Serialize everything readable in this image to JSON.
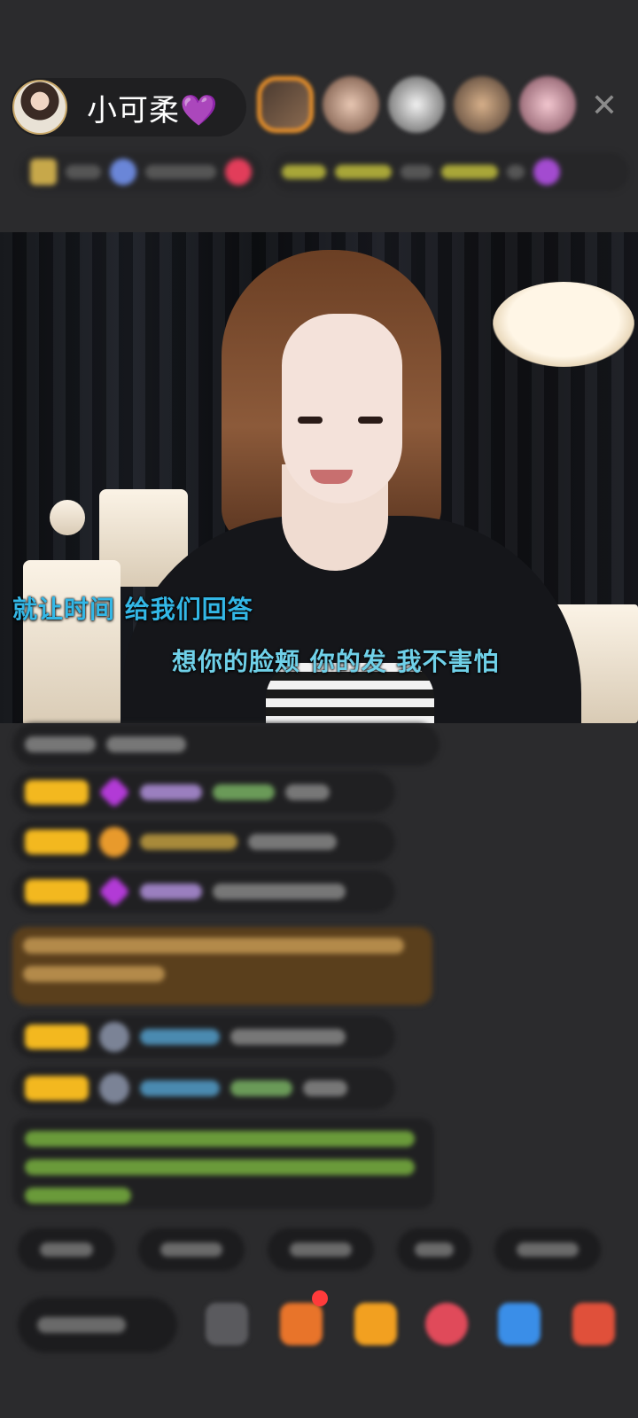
{
  "header": {
    "host_name": "小可柔💜",
    "close_glyph": "✕"
  },
  "video": {
    "lyric_line_1": "就让时间  给我们回答",
    "lyric_line_2": "想你的脸颊  你的发  我不害怕"
  },
  "icons": {
    "avatar": "host-avatar",
    "close": "close-icon",
    "gift": "gift-icon"
  },
  "colors": {
    "background": "#2b2b2d",
    "lyric_primary": "#33b7e6",
    "lyric_secondary": "#6fd0e8",
    "badge": "#f3b81f"
  }
}
